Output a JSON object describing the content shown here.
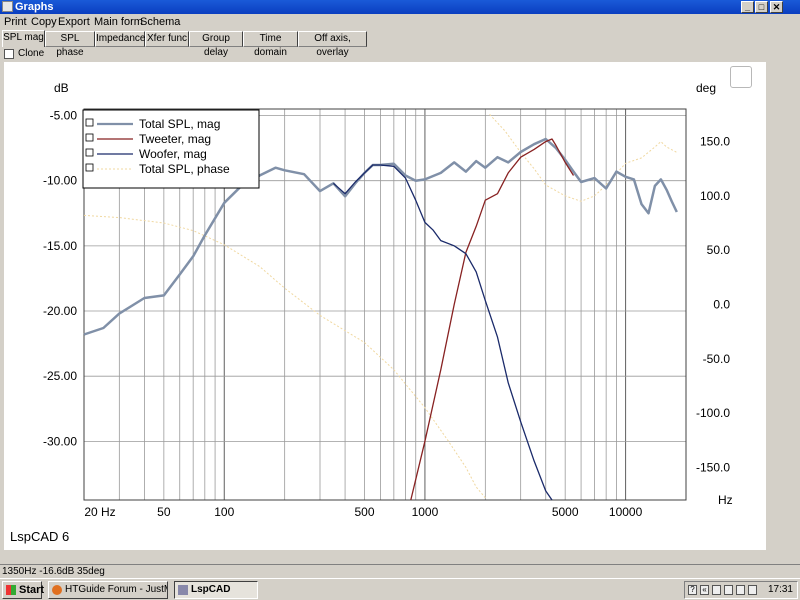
{
  "window": {
    "title": "Graphs",
    "min_glyph": "_",
    "max_glyph": "□",
    "close_glyph": "✕"
  },
  "menu": [
    "Print",
    "Copy",
    "Export",
    "Main form",
    "Schema"
  ],
  "tabs": [
    "SPL mag",
    "SPL phase",
    "Impedance",
    "Xfer func",
    "Group delay",
    "Time domain",
    "Off axis, overlay"
  ],
  "active_tab": 0,
  "clone_label": "Clone",
  "graph": {
    "watermark": "LspCAD 6",
    "left_unit": "dB",
    "right_unit": "deg",
    "x_unit": "Hz"
  },
  "chart_data": {
    "type": "line",
    "x_scale": "log",
    "xlim": [
      20,
      20000
    ],
    "ylim_left": [
      -34.5,
      -4.5
    ],
    "ylim_right": [
      -180,
      180
    ],
    "x_tick_labels": [
      {
        "value": 20,
        "label": "20 Hz"
      },
      {
        "value": 50,
        "label": "50"
      },
      {
        "value": 100,
        "label": "100"
      },
      {
        "value": 500,
        "label": "500"
      },
      {
        "value": 1000,
        "label": "1000"
      },
      {
        "value": 5000,
        "label": "5000"
      },
      {
        "value": 10000,
        "label": "10000"
      }
    ],
    "y_left_ticks": [
      {
        "value": -5,
        "label": "-5.00"
      },
      {
        "value": -10,
        "label": "-10.00"
      },
      {
        "value": -15,
        "label": "-15.00"
      },
      {
        "value": -20,
        "label": "-20.00"
      },
      {
        "value": -25,
        "label": "-25.00"
      },
      {
        "value": -30,
        "label": "-30.00"
      }
    ],
    "y_right_ticks": [
      {
        "value": 150,
        "label": "150.0"
      },
      {
        "value": 100,
        "label": "100.0"
      },
      {
        "value": 50,
        "label": "50.0"
      },
      {
        "value": 0,
        "label": "0.0"
      },
      {
        "value": -50,
        "label": "-50.0"
      },
      {
        "value": -100,
        "label": "-100.0"
      },
      {
        "value": -150,
        "label": "-150.0"
      }
    ],
    "series": [
      {
        "name": "Total SPL, mag",
        "axis": "left",
        "color": "#8090a8",
        "width": 2.5,
        "x": [
          20,
          25,
          30,
          40,
          50,
          60,
          70,
          80,
          100,
          120,
          150,
          180,
          200,
          250,
          300,
          350,
          400,
          450,
          500,
          550,
          600,
          700,
          800,
          900,
          1000,
          1200,
          1400,
          1600,
          1800,
          2000,
          2300,
          2600,
          3000,
          3500,
          4000,
          4500,
          5000,
          5500,
          6000,
          7000,
          8000,
          9000,
          10000,
          11000,
          12000,
          13000,
          14000,
          15000,
          16000,
          17000,
          18000
        ],
        "y": [
          -21.8,
          -21.3,
          -20.2,
          -19,
          -18.8,
          -17.2,
          -15.8,
          -14.2,
          -11.7,
          -10.5,
          -9.6,
          -9.0,
          -9.2,
          -9.5,
          -10.8,
          -10.2,
          -11.2,
          -10.2,
          -9.4,
          -8.8,
          -8.8,
          -8.7,
          -9.6,
          -10.0,
          -9.9,
          -9.4,
          -8.6,
          -9.3,
          -8.5,
          -9.0,
          -8.2,
          -8.6,
          -7.8,
          -7.2,
          -6.8,
          -7.5,
          -8.4,
          -9.3,
          -10.1,
          -9.8,
          -10.6,
          -9.3,
          -9.7,
          -9.9,
          -11.8,
          -12.5,
          -10.4,
          -9.9,
          -10.7,
          -11.6,
          -12.4
        ]
      },
      {
        "name": "Tweeter, mag",
        "axis": "left",
        "color": "#882222",
        "width": 1.3,
        "x": [
          850,
          1000,
          1200,
          1400,
          1600,
          1800,
          2000,
          2300,
          2600,
          3000,
          3500,
          4000,
          4300,
          4500,
          5000,
          5500
        ],
        "y": [
          -34.5,
          -30,
          -24.5,
          -19.5,
          -15.5,
          -13.5,
          -11.5,
          -11.0,
          -9.4,
          -8.2,
          -7.6,
          -7.0,
          -6.8,
          -7.3,
          -8.6,
          -9.6
        ]
      },
      {
        "name": "Woofer, mag",
        "axis": "left",
        "color": "#1a2a6a",
        "width": 1.3,
        "x": [
          350,
          400,
          450,
          500,
          550,
          600,
          700,
          800,
          900,
          1000,
          1100,
          1200,
          1400,
          1600,
          1800,
          2000,
          2300,
          2600,
          3000,
          3500,
          4000,
          4300
        ],
        "y": [
          -10.2,
          -11.0,
          -10.1,
          -9.4,
          -8.8,
          -8.8,
          -8.9,
          -9.8,
          -11.5,
          -13.2,
          -13.8,
          -14.6,
          -15.0,
          -15.6,
          -17.0,
          -19.2,
          -22.0,
          -25.5,
          -28.5,
          -31.5,
          -33.8,
          -34.5
        ]
      },
      {
        "name": "Total SPL, phase",
        "axis": "right",
        "color": "#f0d8a0",
        "width": 1,
        "dash": "2,2",
        "x": [
          20,
          30,
          50,
          70,
          100,
          150,
          200,
          300,
          500,
          700,
          1000,
          1300,
          1600,
          1800,
          2000,
          2100,
          2500,
          3000,
          3500,
          4000,
          5000,
          6000,
          7000,
          8000,
          10000,
          12000,
          14000,
          15000,
          16000,
          18000
        ],
        "y": [
          82,
          80,
          75,
          68,
          55,
          35,
          15,
          -10,
          -35,
          -60,
          -95,
          -125,
          -150,
          -168,
          -178,
          175,
          160,
          140,
          125,
          110,
          100,
          95,
          100,
          110,
          130,
          135,
          145,
          150,
          145,
          140
        ]
      }
    ]
  },
  "status_text": "1350Hz -16.6dB 35deg",
  "taskbar": {
    "start_label": "Start",
    "items": [
      "HTGuide Forum - JustML...",
      "LspCAD"
    ],
    "clock": "17:31"
  }
}
